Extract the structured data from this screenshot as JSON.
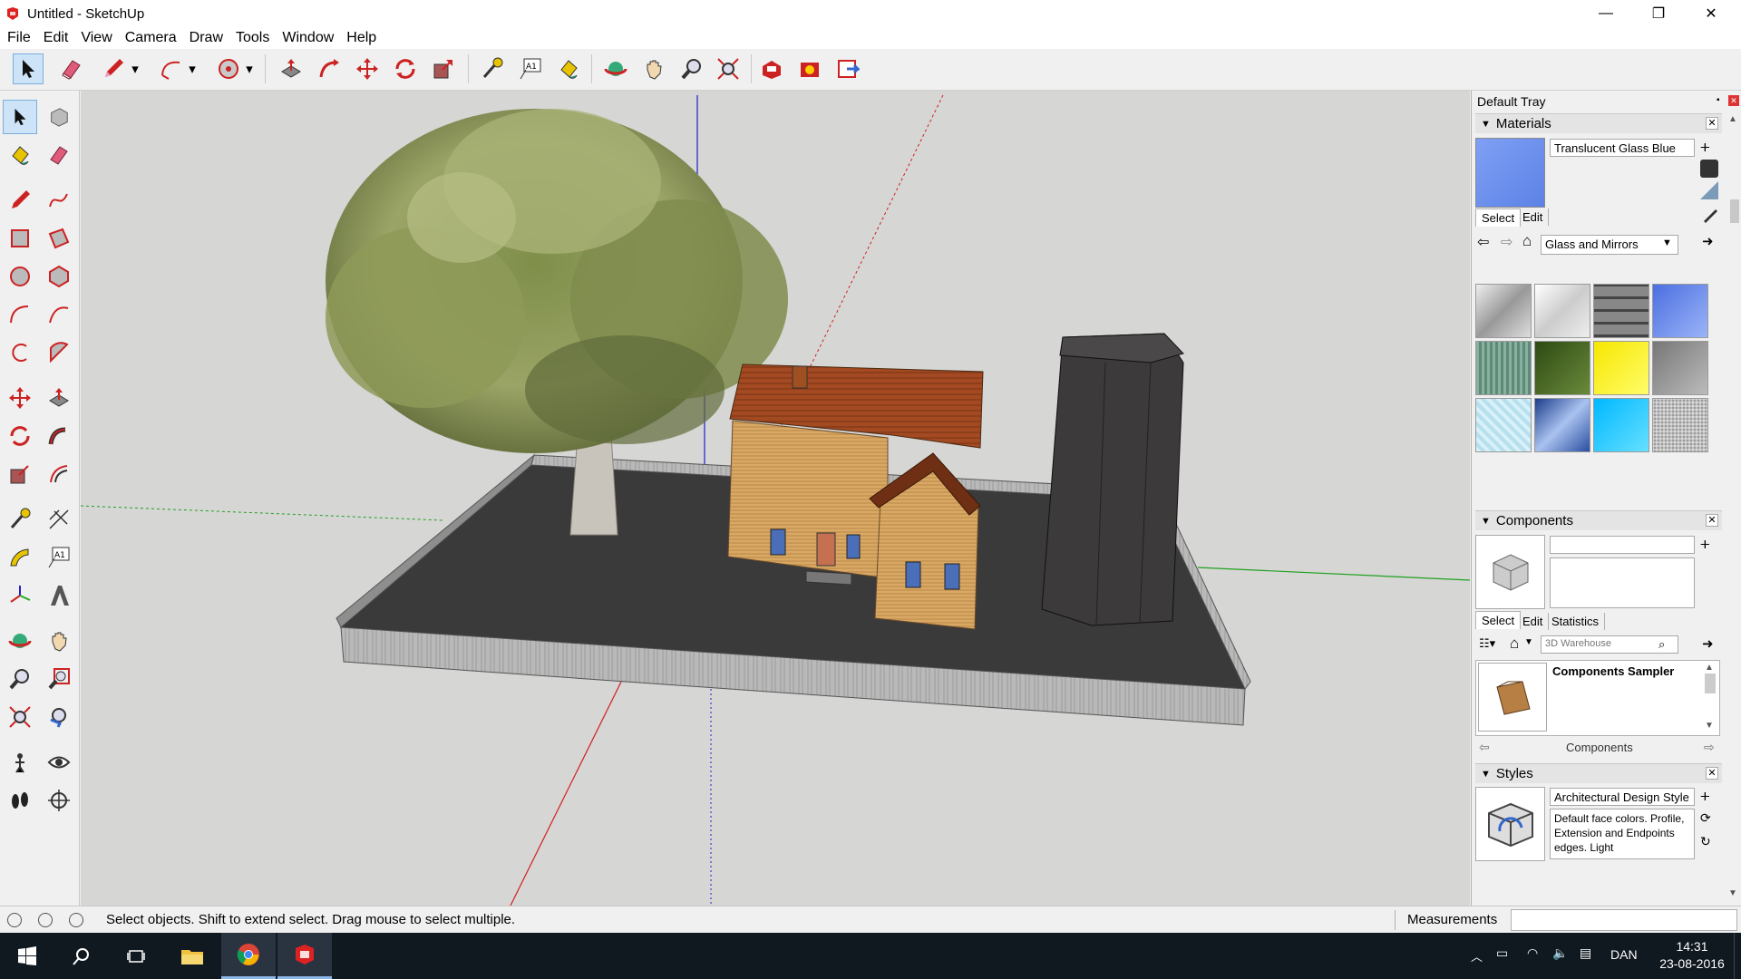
{
  "window": {
    "title": "Untitled - SketchUp",
    "minimize_glyph": "—",
    "restore_glyph": "❐",
    "close_glyph": "✕"
  },
  "menu": [
    "File",
    "Edit",
    "View",
    "Camera",
    "Draw",
    "Tools",
    "Window",
    "Help"
  ],
  "toolbar_icons": [
    "select",
    "eraser",
    "pencil",
    "arc",
    "circle",
    "push-pull",
    "follow-me",
    "move",
    "rotate",
    "scale",
    "tape-measure",
    "text",
    "paint-bucket",
    "orbit",
    "pan",
    "zoom",
    "zoom-extents",
    "3d-warehouse",
    "extension-warehouse",
    "send-to-layout"
  ],
  "tray": {
    "title": "Default Tray",
    "materials": {
      "header": "Materials",
      "current_name": "Translucent Glass Blue",
      "tab_select": "Select",
      "tab_edit": "Edit",
      "library": "Glass and Mirrors"
    },
    "components": {
      "header": "Components",
      "tab_select": "Select",
      "tab_edit": "Edit",
      "tab_statistics": "Statistics",
      "search_placeholder": "3D Warehouse",
      "item_title": "Components Sampler",
      "footer": "Components"
    },
    "styles": {
      "header": "Styles",
      "name": "Architectural Design Style",
      "description": "Default face colors. Profile, Extension and Endpoints edges. Light"
    }
  },
  "status": {
    "message": "Select objects. Shift to extend select. Drag mouse to select multiple.",
    "measurements_label": "Measurements"
  },
  "taskbar": {
    "language": "DAN",
    "time": "14:31",
    "date": "23-08-2016"
  },
  "colors": {
    "accent": "#cde3f7",
    "viewport_bg": "#d6d6d4",
    "glass_blue": "#6e92ef",
    "axis_red": "#d02020",
    "axis_green": "#20a020",
    "axis_blue": "#2020d0",
    "taskbar": "#101820"
  }
}
